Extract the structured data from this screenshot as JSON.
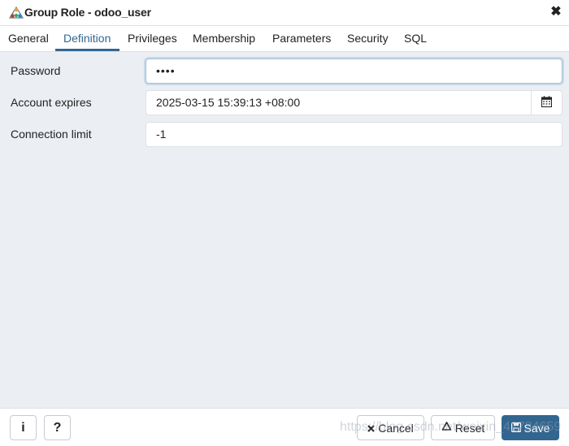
{
  "dialog": {
    "title": "Group Role - odoo_user",
    "close_glyph": "✖"
  },
  "tabs": [
    {
      "label": "General",
      "active": false
    },
    {
      "label": "Definition",
      "active": true
    },
    {
      "label": "Privileges",
      "active": false
    },
    {
      "label": "Membership",
      "active": false
    },
    {
      "label": "Parameters",
      "active": false
    },
    {
      "label": "Security",
      "active": false
    },
    {
      "label": "SQL",
      "active": false
    }
  ],
  "form": {
    "password": {
      "label": "Password",
      "value": "••••"
    },
    "account_expires": {
      "label": "Account expires",
      "value": "2025-03-15 15:39:13 +08:00"
    },
    "connection_limit": {
      "label": "Connection limit",
      "value": "-1"
    }
  },
  "footer": {
    "info_label": "i",
    "help_label": "?",
    "cancel_label": "Cancel",
    "reset_label": "Reset",
    "save_label": "Save"
  },
  "watermark": "https://blog.csdn.net/weixin_42734659",
  "colors": {
    "accent": "#326690",
    "background": "#ebeef3",
    "border": "#dde0e6"
  }
}
